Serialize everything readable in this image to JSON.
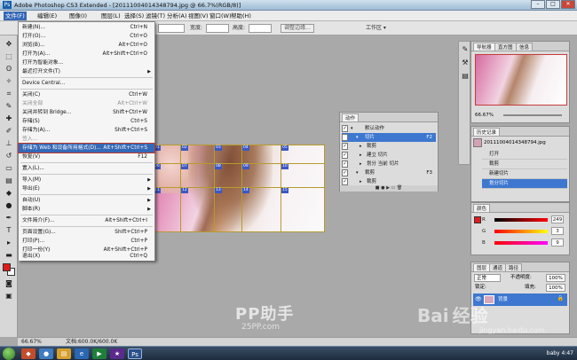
{
  "app": {
    "title": "Adobe Photoshop CS3 Extended - [2011100401434879​4.jpg @ 66.7%(RGB/8)]",
    "ps_logo": "Ps",
    "window_buttons": [
      "–",
      "□",
      "✕"
    ]
  },
  "menubar": {
    "items": [
      "文件(F)",
      "编辑(E)",
      "图像(I)",
      "图层(L)",
      "选择(S)",
      "滤镜(T)",
      "分析(A)",
      "视图(V)",
      "窗口(W)",
      "帮助(H)"
    ]
  },
  "options_bar": {
    "width_label": "宽度:",
    "height_label": "高度:",
    "adjust_edge_label": "调整边缘...",
    "workspace_label": "工作区 ▾"
  },
  "file_menu": {
    "items": [
      {
        "label": "新建(N)...",
        "shortcut": "Ctrl+N"
      },
      {
        "label": "打开(O)...",
        "shortcut": "Ctrl+O"
      },
      {
        "label": "浏览(B)...",
        "shortcut": "Alt+Ctrl+O"
      },
      {
        "label": "打开为(A)...",
        "shortcut": "Alt+Shift+Ctrl+O"
      },
      {
        "label": "打开为智能对象...",
        "shortcut": ""
      },
      {
        "label": "最近打开文件(T)",
        "shortcut": "",
        "submenu": true
      },
      {
        "label": "Device Central...",
        "shortcut": ""
      },
      {
        "label": "关闭(C)",
        "shortcut": "Ctrl+W"
      },
      {
        "label": "关闭全部",
        "shortcut": "Alt+Ctrl+W",
        "disabled": true
      },
      {
        "label": "关闭并转到 Bridge...",
        "shortcut": "Shift+Ctrl+W"
      },
      {
        "label": "存储(S)",
        "shortcut": "Ctrl+S"
      },
      {
        "label": "存储为(A)...",
        "shortcut": "Shift+Ctrl+S"
      },
      {
        "label": "签入...",
        "shortcut": "",
        "disabled": true
      },
      {
        "label": "存储为 Web 和设备所用格式(D)...",
        "shortcut": "Alt+Shift+Ctrl+S",
        "highlighted": true
      },
      {
        "label": "恢复(V)",
        "shortcut": "F12"
      },
      {
        "label": "置入(L)...",
        "shortcut": ""
      },
      {
        "label": "导入(M)",
        "shortcut": "",
        "submenu": true
      },
      {
        "label": "导出(E)",
        "shortcut": "",
        "submenu": true
      },
      {
        "label": "自动(U)",
        "shortcut": "",
        "submenu": true
      },
      {
        "label": "脚本(R)",
        "shortcut": "",
        "submenu": true
      },
      {
        "label": "文件简介(F)...",
        "shortcut": "Alt+Shift+Ctrl+I"
      },
      {
        "label": "页面设置(G)...",
        "shortcut": "Shift+Ctrl+P"
      },
      {
        "label": "打印(P)...",
        "shortcut": "Ctrl+P"
      },
      {
        "label": "打印一份(Y)",
        "shortcut": "Alt+Shift+Ctrl+P"
      },
      {
        "label": "退出(X)",
        "shortcut": "Ctrl+Q"
      }
    ]
  },
  "slices": {
    "tags": [
      "01",
      "02",
      "03",
      "04",
      "05",
      "06",
      "07",
      "08",
      "09",
      "10",
      "11",
      "12",
      "13",
      "14",
      "15"
    ]
  },
  "actions_panel": {
    "tab": "动作",
    "rows": [
      {
        "label": "默认动作",
        "shortcut": ""
      },
      {
        "label": "切片",
        "shortcut": "F2",
        "selected": true
      },
      {
        "label": "裁剪",
        "shortcut": ""
      },
      {
        "label": "建立 切片",
        "shortcut": ""
      },
      {
        "label": "划分 当前 切片",
        "shortcut": ""
      },
      {
        "label": "裁剪",
        "shortcut": "F3"
      },
      {
        "label": "裁剪",
        "shortcut": ""
      },
      {
        "label": "建立 切片",
        "shortcut": ""
      }
    ]
  },
  "navigator_panel": {
    "tabs": [
      "导航器",
      "直方图",
      "信息"
    ],
    "zoom": "66.67%"
  },
  "history_panel": {
    "tabs": [
      "历史记录"
    ],
    "snapshot": "20111004014348794.jpg",
    "rows": [
      "打开",
      "裁剪",
      "新建切片",
      "划分切片"
    ]
  },
  "color_panel": {
    "tab": "颜色",
    "channels": [
      {
        "label": "R",
        "value": "249"
      },
      {
        "label": "G",
        "value": "3"
      },
      {
        "label": "B",
        "value": "9"
      }
    ]
  },
  "layers_panel": {
    "tabs": [
      "图层",
      "通道",
      "路径"
    ],
    "blend_mode": "正常",
    "opacity_label": "不透明度:",
    "opacity": "100%",
    "lock_label": "锁定:",
    "fill_label": "填充:",
    "fill": "100%",
    "layer_name": "背景"
  },
  "status": {
    "zoom": "66.67%",
    "doc_info": "文档:600.0K/600.0K"
  },
  "taskbar": {
    "clock": "baby 4:47"
  },
  "watermarks": {
    "pp": "PP助手",
    "pp_url": "25PP.com",
    "baidu": "Bai 经验",
    "baidu_url": "jingyan.baidu.com"
  },
  "colors": {
    "foreground": "#e01b1b",
    "highlight": "#3568b6",
    "slice_line": "#b79b2e"
  }
}
